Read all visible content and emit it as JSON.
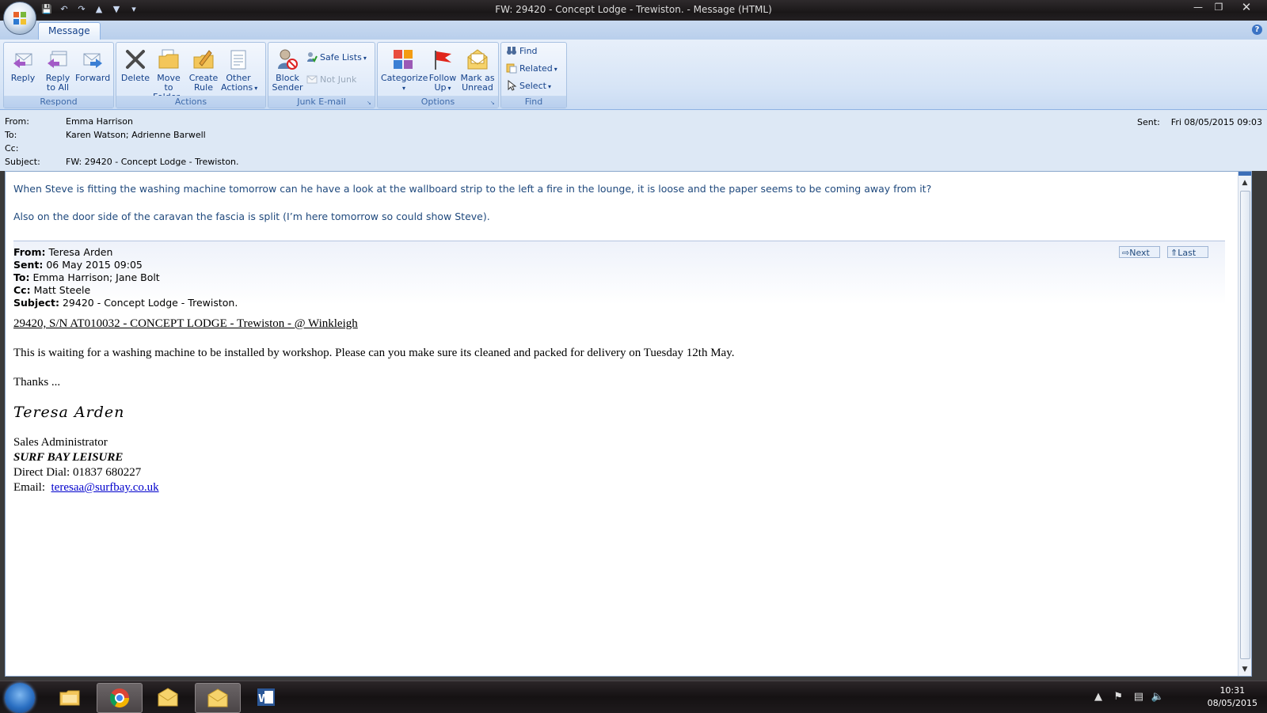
{
  "window": {
    "title": "FW: 29420 - Concept Lodge - Trewiston.  - Message (HTML)",
    "controls": {
      "minimize": "—",
      "maximize": "❐",
      "close": "✕"
    }
  },
  "quick_access": [
    "save-icon",
    "undo-icon",
    "redo-icon",
    "previous-icon",
    "next-icon",
    "customize-icon"
  ],
  "ribbon": {
    "tab": "Message",
    "groups": {
      "respond": {
        "label": "Respond",
        "reply": "Reply",
        "reply_all": "Reply\nto All",
        "forward": "Forward"
      },
      "actions": {
        "label": "Actions",
        "delete": "Delete",
        "move_to_folder": "Move to\nFolder",
        "create_rule": "Create\nRule",
        "other_actions": "Other\nActions"
      },
      "junk": {
        "label": "Junk E-mail",
        "block_sender": "Block\nSender",
        "safe_lists": "Safe Lists",
        "not_junk": "Not Junk"
      },
      "options": {
        "label": "Options",
        "categorize": "Categorize",
        "follow_up": "Follow\nUp",
        "mark_unread": "Mark as\nUnread"
      },
      "find": {
        "label": "Find",
        "find": "Find",
        "related": "Related",
        "select": "Select"
      }
    }
  },
  "header": {
    "from_label": "From:",
    "from": "Emma Harrison",
    "to_label": "To:",
    "to": "Karen Watson; Adrienne Barwell",
    "cc_label": "Cc:",
    "cc": "",
    "subject_label": "Subject:",
    "subject": "FW: 29420 - Concept Lodge - Trewiston.",
    "sent_label": "Sent:",
    "sent": "Fri 08/05/2015 09:03"
  },
  "body": {
    "line1": "When Steve is fitting the washing machine tomorrow can he have a look at the wallboard strip to the left a fire in the lounge, it is loose and the paper seems to be coming away from it?",
    "line2": "Also on the door side of the caravan the fascia is split (I’m here tomorrow so could show Steve).",
    "original": {
      "from_label": "From:",
      "from": "Teresa Arden",
      "sent_label": "Sent:",
      "sent": "06 May 2015 09:05",
      "to_label": "To:",
      "to": "Emma Harrison; Jane Bolt",
      "cc_label": "Cc:",
      "cc": "Matt Steele",
      "subject_label": "Subject:",
      "subject": "29420 - Concept Lodge - Trewiston.",
      "next": "Next",
      "last": "Last"
    },
    "reference": "29420, S/N AT010032 - CONCEPT LODGE - Trewiston - @ Winkleigh",
    "paragraph": "This is waiting for a washing machine to be installed by workshop.  Please can you make sure its cleaned and packed for delivery on Tuesday 12th May.",
    "thanks": "Thanks ...",
    "signature": "Teresa Arden",
    "sig_title": "Sales Administrator",
    "sig_company": "SURF BAY LEISURE",
    "sig_phone": "Direct Dial:  01837 680227",
    "sig_email_label": "Email:",
    "sig_email": "teresaa@surfbay.co.uk"
  },
  "taskbar": {
    "apps": [
      "file-explorer-icon",
      "chrome-icon",
      "outlook-icon",
      "outlook-message-icon",
      "word-icon"
    ],
    "time": "10:31",
    "date": "08/05/2015"
  }
}
